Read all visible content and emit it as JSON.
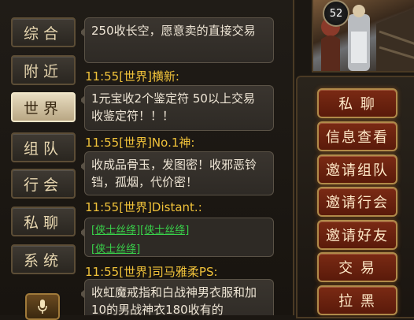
{
  "tabs": [
    {
      "label": "综合",
      "active": false
    },
    {
      "label": "附近",
      "active": false
    },
    {
      "label": "世界",
      "active": true
    },
    {
      "label": "组队",
      "active": false
    },
    {
      "label": "行会",
      "active": false
    },
    {
      "label": "私聊",
      "active": false
    },
    {
      "label": "系统",
      "active": false
    }
  ],
  "messages": {
    "m0": {
      "text": "250收长空，愿意卖的直接交易"
    },
    "m1": {
      "sender": "11:55[世界]横新:",
      "text": "1元宝收2个鉴定符 50以上交易 收鉴定符！！！"
    },
    "m2": {
      "sender": "11:55[世界]No.1神:",
      "text": "收成品骨玉，发图密！收邪恶铃铛，孤烟，代价密！"
    },
    "m3": {
      "sender": "11:55[世界]Distant.:",
      "items": [
        "[侠士丝绦]",
        "[侠士丝绦]",
        "[侠士丝绦]"
      ]
    },
    "m4": {
      "sender": "11:55[世界]司马雅柔PS:",
      "text": "收虹魔戒指和白战神男衣服和加10的男战神衣180收有的"
    }
  },
  "player": {
    "level": "52"
  },
  "actions": {
    "private_chat": "私 聊",
    "view_info": "信息查看",
    "invite_team": "邀请组队",
    "invite_guild": "邀请行会",
    "invite_friend": "邀请好友",
    "trade": "交 易",
    "block": "拉 黑"
  },
  "icons": {
    "mic": "microphone-icon"
  },
  "colors": {
    "sender": "#f0c23a",
    "item_link": "#39d24a",
    "action_button": "#7a2a14"
  }
}
